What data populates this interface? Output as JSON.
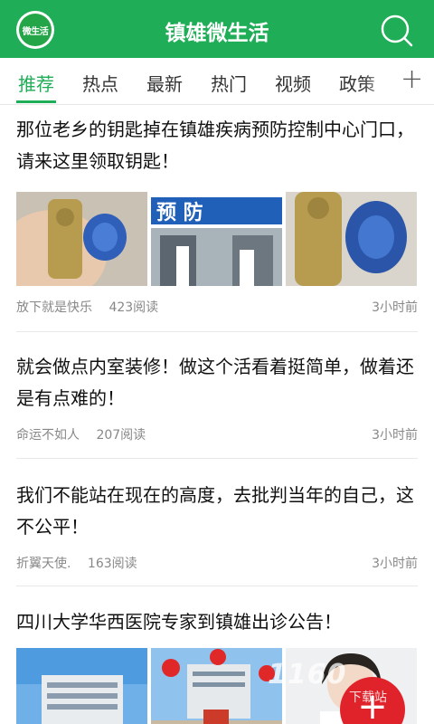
{
  "header": {
    "app_title": "镇雄微生活",
    "logo_text": "微生活"
  },
  "tabs": [
    {
      "label": "推荐",
      "active": true
    },
    {
      "label": "热点",
      "active": false
    },
    {
      "label": "最新",
      "active": false
    },
    {
      "label": "热门",
      "active": false
    },
    {
      "label": "视频",
      "active": false
    },
    {
      "label": "政策",
      "active": false
    }
  ],
  "tabs_more_label": "+",
  "articles": [
    {
      "title": "那位老乡的钥匙掉在镇雄疾病预防控制中心门口，请来这里领取钥匙！",
      "author": "放下就是快乐",
      "reads": "423阅读",
      "time": "3小时前",
      "image_texts": [
        "",
        "预 防",
        ""
      ]
    },
    {
      "title": "就会做点内室装修！做这个活看着挺简单，做着还是有点难的！",
      "author": "命运不如人",
      "reads": "207阅读",
      "time": "3小时前"
    },
    {
      "title": "我们不能站在现在的高度，去批判当年的自己，这不公平！",
      "author": "折翼天使.",
      "reads": "163阅读",
      "time": "3小时前"
    },
    {
      "title": "四川大学华西医院专家到镇雄出诊公告！"
    }
  ],
  "fab_label": "+",
  "watermark": {
    "main": "1160",
    "sub": "下载站"
  },
  "colors": {
    "brand_green": "#1fae57",
    "fab_red": "#e0232b"
  }
}
